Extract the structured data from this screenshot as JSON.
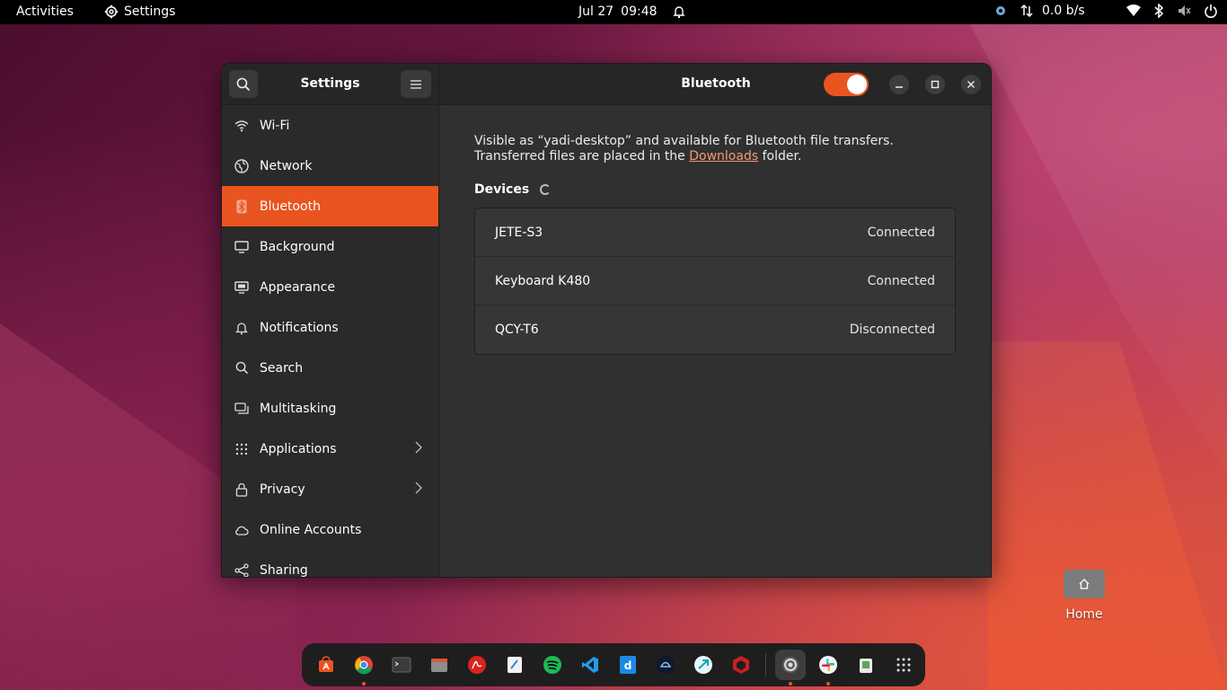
{
  "topbar": {
    "activities": "Activities",
    "app_name": "Settings",
    "date": "Jul 27",
    "time": "09:48",
    "net_speed": "0.0  b/s"
  },
  "window": {
    "sidebar_title": "Settings",
    "content_title": "Bluetooth",
    "bluetooth_enabled": true,
    "sidebar_items": [
      {
        "label": "Wi-Fi",
        "icon": "wifi-icon"
      },
      {
        "label": "Network",
        "icon": "globe-icon"
      },
      {
        "label": "Bluetooth",
        "icon": "bluetooth-icon",
        "active": true
      },
      {
        "label": "Background",
        "icon": "monitor-icon"
      },
      {
        "label": "Appearance",
        "icon": "appearance-icon"
      },
      {
        "label": "Notifications",
        "icon": "bell-icon"
      },
      {
        "label": "Search",
        "icon": "search-icon"
      },
      {
        "label": "Multitasking",
        "icon": "multitasking-icon"
      },
      {
        "label": "Applications",
        "icon": "grid-icon",
        "chevron": true
      },
      {
        "label": "Privacy",
        "icon": "lock-icon",
        "chevron": true
      },
      {
        "label": "Online Accounts",
        "icon": "cloud-icon"
      },
      {
        "label": "Sharing",
        "icon": "share-icon"
      }
    ]
  },
  "bluetooth": {
    "description_prefix": "Visible as “yadi-desktop” and available for Bluetooth file transfers. Transferred files are placed in the ",
    "downloads_link": "Downloads",
    "description_suffix": " folder.",
    "devices_label": "Devices",
    "devices": [
      {
        "name": "JETE-S3",
        "status": "Connected"
      },
      {
        "name": "Keyboard K480",
        "status": "Connected"
      },
      {
        "name": "QCY-T6",
        "status": "Disconnected"
      }
    ]
  },
  "desktop": {
    "home_label": "Home"
  },
  "colors": {
    "accent": "#e95420",
    "topbar": "#000000",
    "window_bg": "#303030"
  }
}
